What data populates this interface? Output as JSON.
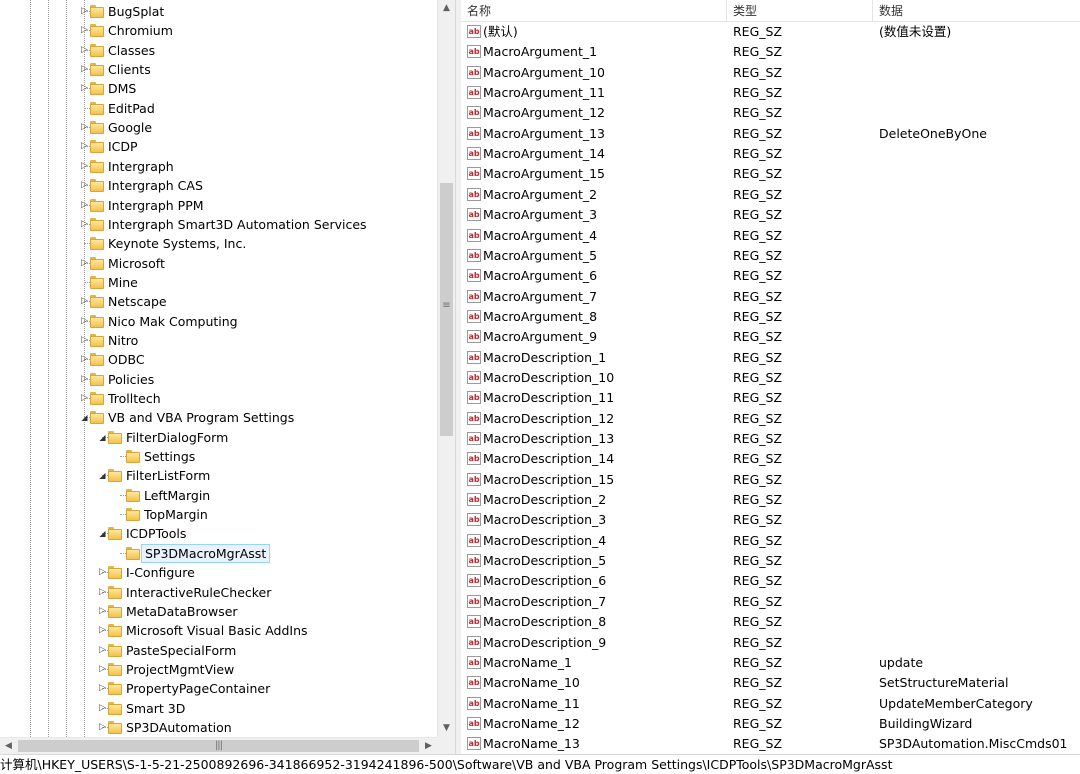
{
  "tree": {
    "items": [
      {
        "label": "BugSplat",
        "depth": 0,
        "expander": "closed"
      },
      {
        "label": "Chromium",
        "depth": 0,
        "expander": "closed"
      },
      {
        "label": "Classes",
        "depth": 0,
        "expander": "closed"
      },
      {
        "label": "Clients",
        "depth": 0,
        "expander": "closed"
      },
      {
        "label": "DMS",
        "depth": 0,
        "expander": "closed"
      },
      {
        "label": "EditPad",
        "depth": 0,
        "expander": "none"
      },
      {
        "label": "Google",
        "depth": 0,
        "expander": "closed"
      },
      {
        "label": "ICDP",
        "depth": 0,
        "expander": "closed"
      },
      {
        "label": "Intergraph",
        "depth": 0,
        "expander": "closed"
      },
      {
        "label": "Intergraph CAS",
        "depth": 0,
        "expander": "closed"
      },
      {
        "label": "Intergraph PPM",
        "depth": 0,
        "expander": "closed"
      },
      {
        "label": "Intergraph Smart3D Automation Services",
        "depth": 0,
        "expander": "closed"
      },
      {
        "label": "Keynote Systems, Inc.",
        "depth": 0,
        "expander": "none"
      },
      {
        "label": "Microsoft",
        "depth": 0,
        "expander": "closed"
      },
      {
        "label": "Mine",
        "depth": 0,
        "expander": "none"
      },
      {
        "label": "Netscape",
        "depth": 0,
        "expander": "closed"
      },
      {
        "label": "Nico Mak Computing",
        "depth": 0,
        "expander": "closed"
      },
      {
        "label": "Nitro",
        "depth": 0,
        "expander": "closed"
      },
      {
        "label": "ODBC",
        "depth": 0,
        "expander": "closed"
      },
      {
        "label": "Policies",
        "depth": 0,
        "expander": "closed"
      },
      {
        "label": "Trolltech",
        "depth": 0,
        "expander": "closed"
      },
      {
        "label": "VB and VBA Program Settings",
        "depth": 0,
        "expander": "open"
      },
      {
        "label": "FilterDialogForm",
        "depth": 1,
        "expander": "open"
      },
      {
        "label": "Settings",
        "depth": 2,
        "expander": "none"
      },
      {
        "label": "FilterListForm",
        "depth": 1,
        "expander": "open"
      },
      {
        "label": "LeftMargin",
        "depth": 2,
        "expander": "none"
      },
      {
        "label": "TopMargin",
        "depth": 2,
        "expander": "none"
      },
      {
        "label": "ICDPTools",
        "depth": 1,
        "expander": "open"
      },
      {
        "label": "SP3DMacroMgrAsst",
        "depth": 2,
        "expander": "none",
        "selected": true
      },
      {
        "label": "I-Configure",
        "depth": 1,
        "expander": "closed"
      },
      {
        "label": "InteractiveRuleChecker",
        "depth": 1,
        "expander": "closed"
      },
      {
        "label": "MetaDataBrowser",
        "depth": 1,
        "expander": "closed"
      },
      {
        "label": "Microsoft Visual Basic AddIns",
        "depth": 1,
        "expander": "closed"
      },
      {
        "label": "PasteSpecialForm",
        "depth": 1,
        "expander": "closed"
      },
      {
        "label": "ProjectMgmtView",
        "depth": 1,
        "expander": "closed"
      },
      {
        "label": "PropertyPageContainer",
        "depth": 1,
        "expander": "closed"
      },
      {
        "label": "Smart 3D",
        "depth": 1,
        "expander": "closed"
      },
      {
        "label": "SP3DAutomation",
        "depth": 1,
        "expander": "closed"
      }
    ]
  },
  "list": {
    "columns": {
      "name": "名称",
      "type": "类型",
      "data": "数据"
    },
    "rows": [
      {
        "name": "(默认)",
        "type": "REG_SZ",
        "data": "(数值未设置)"
      },
      {
        "name": "MacroArgument_1",
        "type": "REG_SZ",
        "data": ""
      },
      {
        "name": "MacroArgument_10",
        "type": "REG_SZ",
        "data": ""
      },
      {
        "name": "MacroArgument_11",
        "type": "REG_SZ",
        "data": ""
      },
      {
        "name": "MacroArgument_12",
        "type": "REG_SZ",
        "data": ""
      },
      {
        "name": "MacroArgument_13",
        "type": "REG_SZ",
        "data": "DeleteOneByOne"
      },
      {
        "name": "MacroArgument_14",
        "type": "REG_SZ",
        "data": ""
      },
      {
        "name": "MacroArgument_15",
        "type": "REG_SZ",
        "data": ""
      },
      {
        "name": "MacroArgument_2",
        "type": "REG_SZ",
        "data": ""
      },
      {
        "name": "MacroArgument_3",
        "type": "REG_SZ",
        "data": ""
      },
      {
        "name": "MacroArgument_4",
        "type": "REG_SZ",
        "data": ""
      },
      {
        "name": "MacroArgument_5",
        "type": "REG_SZ",
        "data": ""
      },
      {
        "name": "MacroArgument_6",
        "type": "REG_SZ",
        "data": ""
      },
      {
        "name": "MacroArgument_7",
        "type": "REG_SZ",
        "data": ""
      },
      {
        "name": "MacroArgument_8",
        "type": "REG_SZ",
        "data": ""
      },
      {
        "name": "MacroArgument_9",
        "type": "REG_SZ",
        "data": ""
      },
      {
        "name": "MacroDescription_1",
        "type": "REG_SZ",
        "data": ""
      },
      {
        "name": "MacroDescription_10",
        "type": "REG_SZ",
        "data": ""
      },
      {
        "name": "MacroDescription_11",
        "type": "REG_SZ",
        "data": ""
      },
      {
        "name": "MacroDescription_12",
        "type": "REG_SZ",
        "data": ""
      },
      {
        "name": "MacroDescription_13",
        "type": "REG_SZ",
        "data": ""
      },
      {
        "name": "MacroDescription_14",
        "type": "REG_SZ",
        "data": ""
      },
      {
        "name": "MacroDescription_15",
        "type": "REG_SZ",
        "data": ""
      },
      {
        "name": "MacroDescription_2",
        "type": "REG_SZ",
        "data": ""
      },
      {
        "name": "MacroDescription_3",
        "type": "REG_SZ",
        "data": ""
      },
      {
        "name": "MacroDescription_4",
        "type": "REG_SZ",
        "data": ""
      },
      {
        "name": "MacroDescription_5",
        "type": "REG_SZ",
        "data": ""
      },
      {
        "name": "MacroDescription_6",
        "type": "REG_SZ",
        "data": ""
      },
      {
        "name": "MacroDescription_7",
        "type": "REG_SZ",
        "data": ""
      },
      {
        "name": "MacroDescription_8",
        "type": "REG_SZ",
        "data": ""
      },
      {
        "name": "MacroDescription_9",
        "type": "REG_SZ",
        "data": ""
      },
      {
        "name": "MacroName_1",
        "type": "REG_SZ",
        "data": "update"
      },
      {
        "name": "MacroName_10",
        "type": "REG_SZ",
        "data": "SetStructureMaterial"
      },
      {
        "name": "MacroName_11",
        "type": "REG_SZ",
        "data": "UpdateMemberCategory"
      },
      {
        "name": "MacroName_12",
        "type": "REG_SZ",
        "data": "BuildingWizard"
      },
      {
        "name": "MacroName_13",
        "type": "REG_SZ",
        "data": "SP3DAutomation.MiscCmds01"
      }
    ]
  },
  "icons": {
    "value_icon_text": "ab",
    "folder": "folder-icon",
    "scroll_up": "▲",
    "scroll_down": "▼",
    "scroll_left": "◀",
    "scroll_right": "▶",
    "vgrip": "≡",
    "hgrip": "|||"
  },
  "status_bar": {
    "path": "计算机\\HKEY_USERS\\S-1-5-21-2500892696-341866952-3194241896-500\\Software\\VB and VBA Program Settings\\ICDPTools\\SP3DMacroMgrAsst"
  },
  "colors": {
    "selection_border": "#99d1ff",
    "selection_fill": "#e8f3fd",
    "ab_icon_text": "#c0282f",
    "folder_fill": "#f2c24e"
  }
}
